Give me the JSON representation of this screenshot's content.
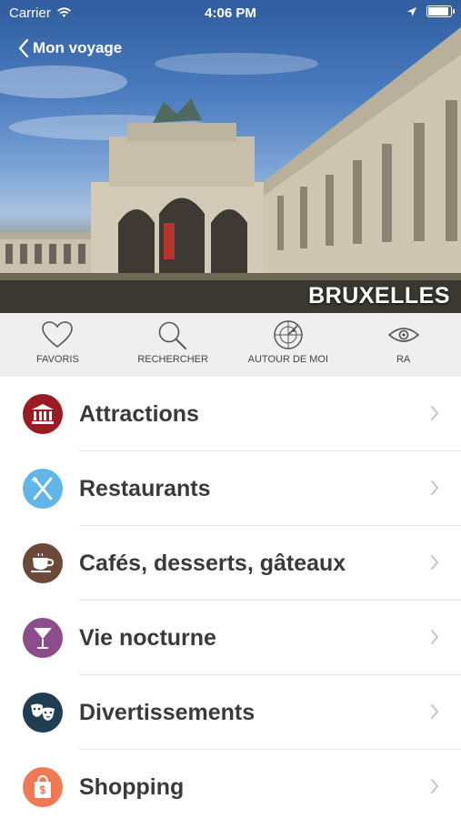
{
  "status": {
    "carrier": "Carrier",
    "time": "4:06 PM"
  },
  "nav": {
    "back_label": "Mon voyage"
  },
  "hero": {
    "city": "BRUXELLES"
  },
  "toolbar": [
    {
      "label": "FAVORIS",
      "icon": "heart-icon"
    },
    {
      "label": "RECHERCHER",
      "icon": "search-icon"
    },
    {
      "label": "AUTOUR DE MOI",
      "icon": "radar-icon"
    },
    {
      "label": "RA",
      "icon": "eye-icon"
    }
  ],
  "categories": [
    {
      "label": "Attractions",
      "icon": "monument-icon",
      "color": "#9b1b22"
    },
    {
      "label": "Restaurants",
      "icon": "fork-knife-icon",
      "color": "#62b6e7"
    },
    {
      "label": "Cafés, desserts, gâteaux",
      "icon": "coffee-cup-icon",
      "color": "#6b4a3a"
    },
    {
      "label": "Vie nocturne",
      "icon": "cocktail-icon",
      "color": "#8b4d8c"
    },
    {
      "label": "Divertissements",
      "icon": "theater-masks-icon",
      "color": "#1f3e52"
    },
    {
      "label": "Shopping",
      "icon": "shopping-bag-icon",
      "color": "#f07a55"
    }
  ]
}
